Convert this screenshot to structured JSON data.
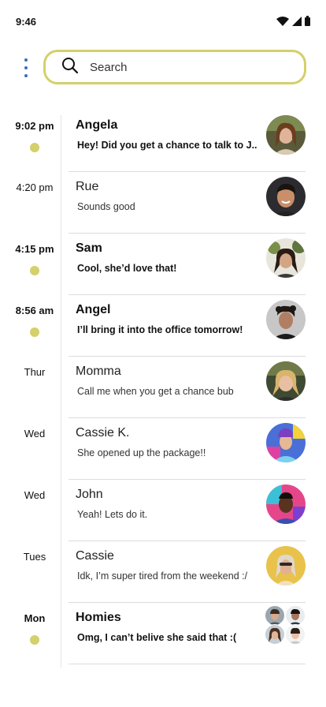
{
  "status": {
    "time": "9:46"
  },
  "search": {
    "placeholder": "Search"
  },
  "threads": [
    {
      "time": "9:02 pm",
      "name": "Angela",
      "message": "Hey! Did you get a chance to talk to J..",
      "unread": true
    },
    {
      "time": "4:20 pm",
      "name": "Rue",
      "message": "Sounds good",
      "unread": false
    },
    {
      "time": "4:15 pm",
      "name": "Sam",
      "message": "Cool, she’d love that!",
      "unread": true
    },
    {
      "time": "8:56 am",
      "name": "Angel",
      "message": "I’ll bring it into the office tomorrow!",
      "unread": true
    },
    {
      "time": "Thur",
      "name": "Momma",
      "message": "Call me when you get a chance bub",
      "unread": false
    },
    {
      "time": "Wed",
      "name": "Cassie K.",
      "message": "She opened up the package!!",
      "unread": false
    },
    {
      "time": "Wed",
      "name": "John",
      "message": "Yeah! Lets do it.",
      "unread": false
    },
    {
      "time": "Tues",
      "name": "Cassie",
      "message": "Idk, I’m super tired from the weekend :/",
      "unread": false
    },
    {
      "time": "Mon",
      "name": "Homies",
      "message": "Omg, I can’t belive she said that :(",
      "unread": true
    }
  ],
  "colors": {
    "accent": "#d4d06a",
    "menu": "#3c6fb4",
    "divider": "#dcdcdc"
  },
  "icons": [
    "menu-icon",
    "search-icon",
    "wifi-icon",
    "signal-icon",
    "battery-icon"
  ]
}
